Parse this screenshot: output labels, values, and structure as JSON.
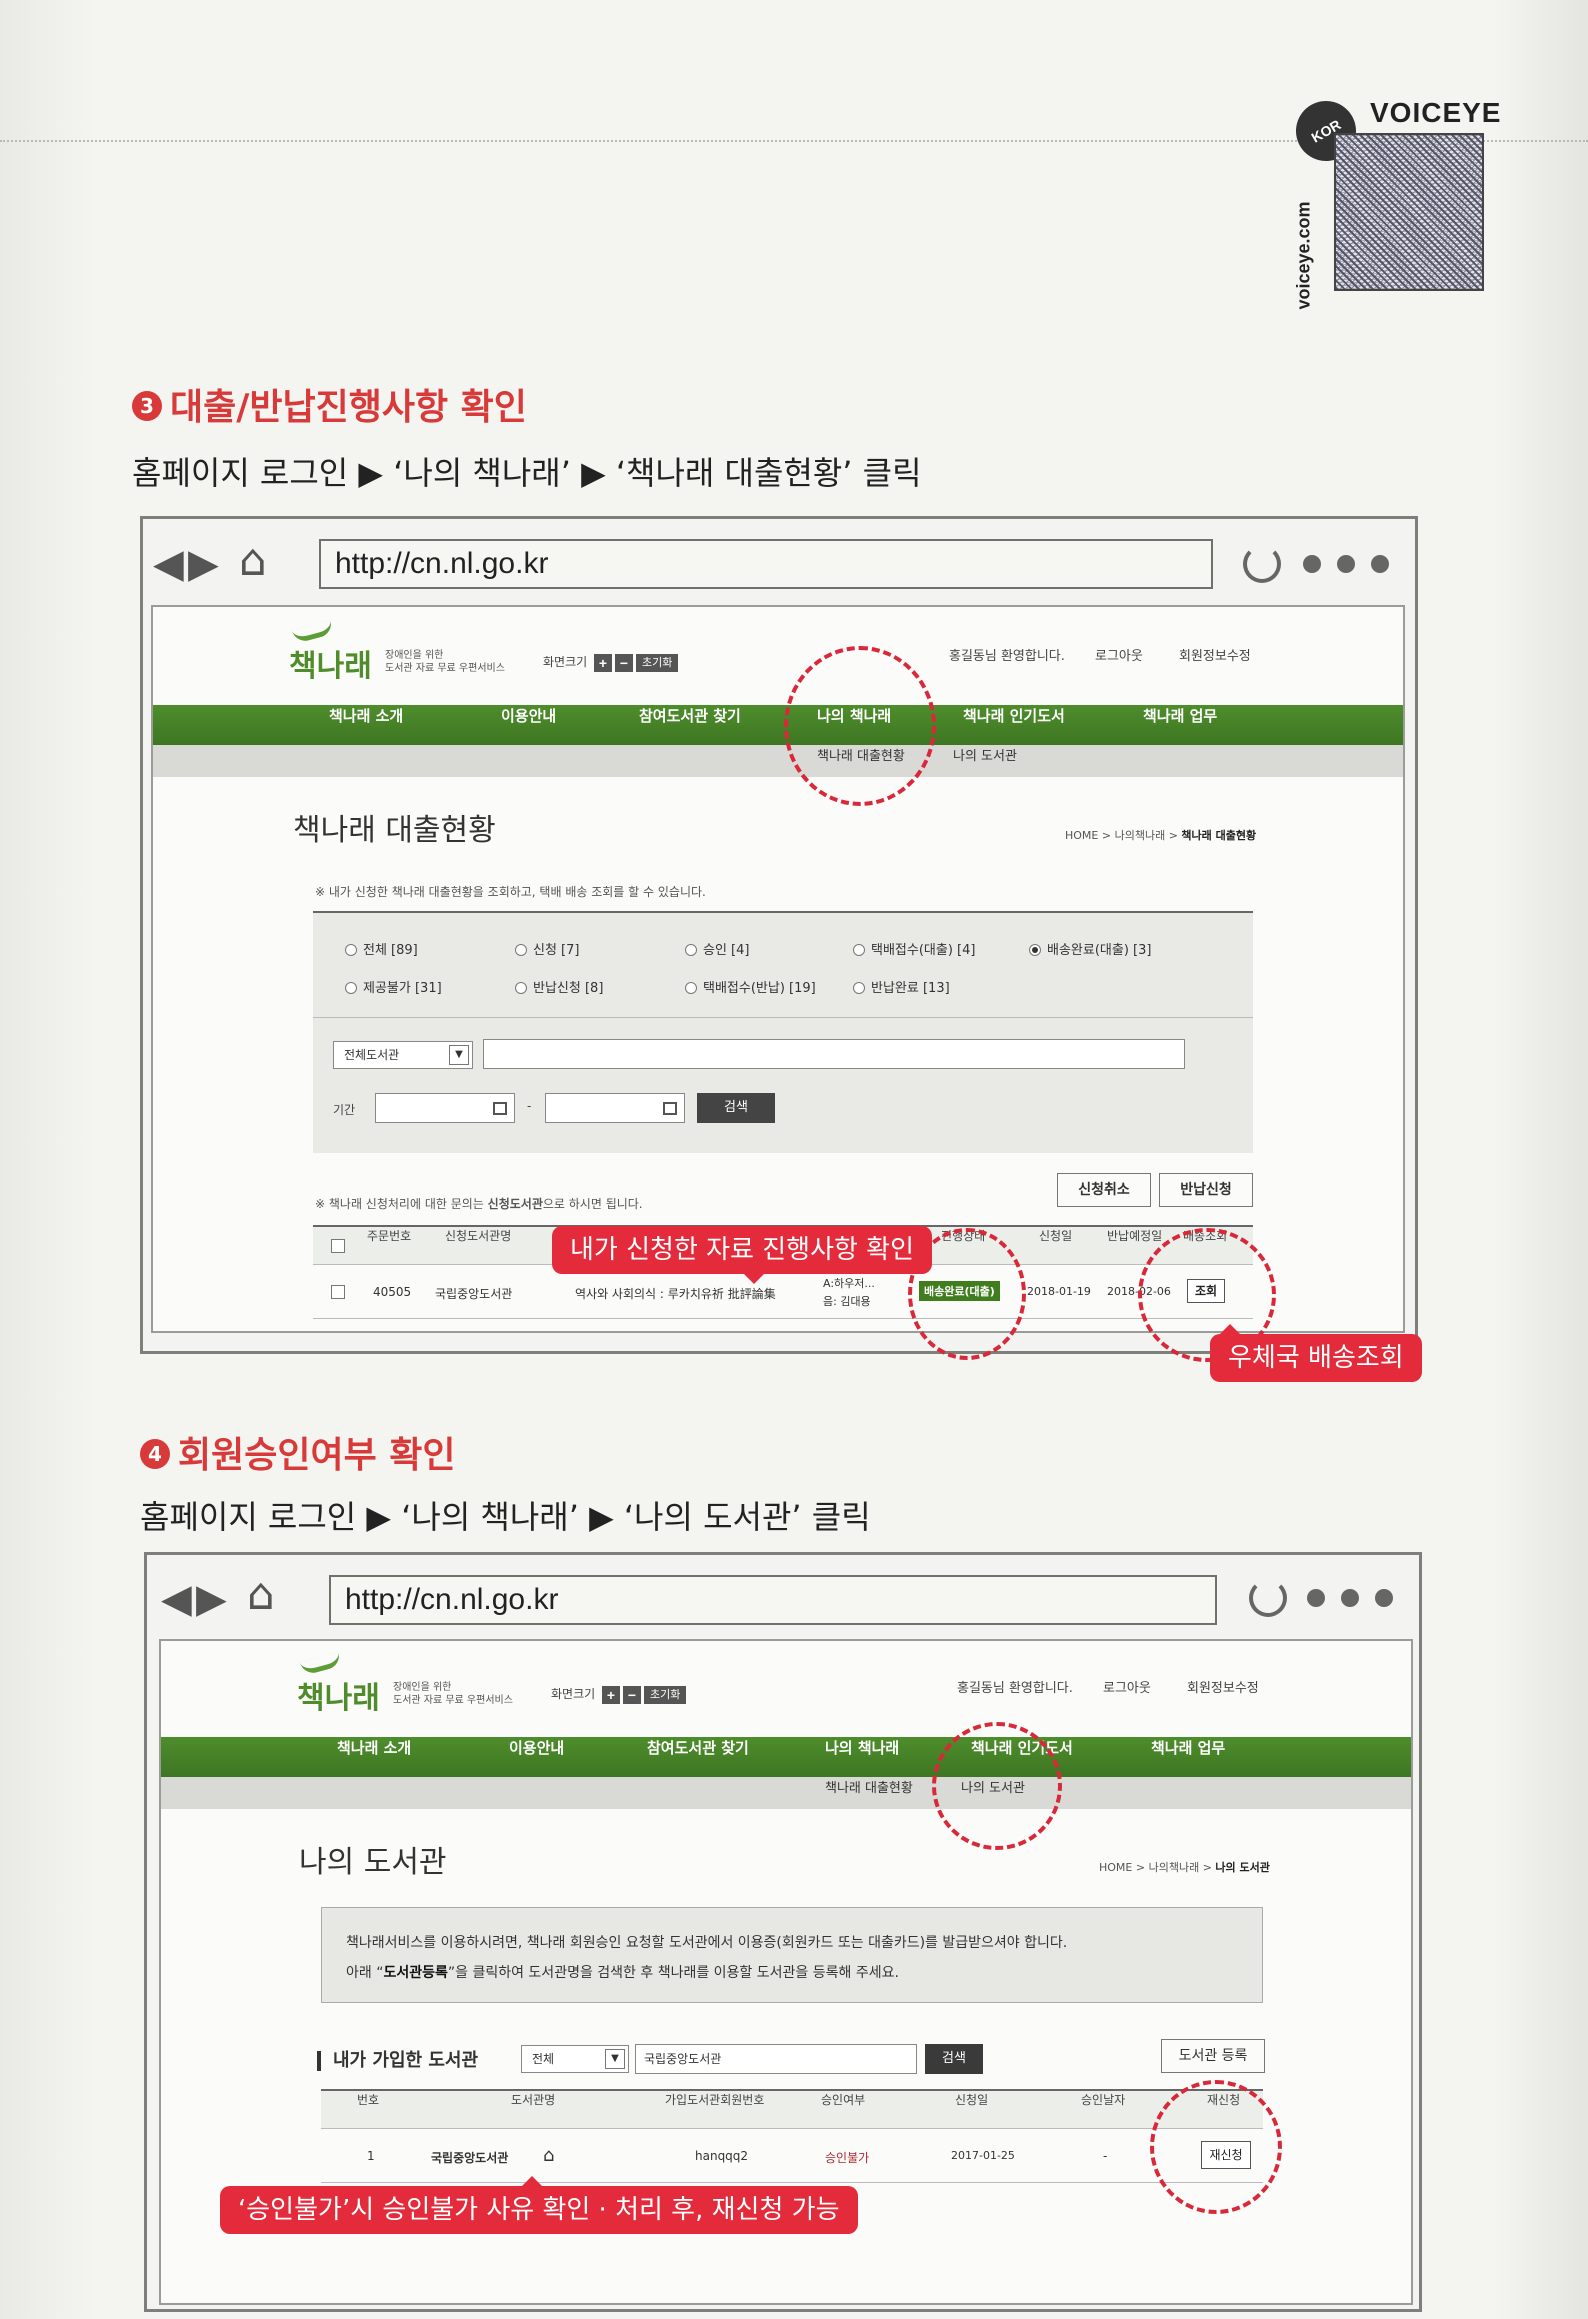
{
  "voiceye": {
    "brand": "VOICEYE",
    "side_text": "voiceye.com",
    "badge": "KOR"
  },
  "section3": {
    "num": "3",
    "title": "대출/반납진행사항 확인",
    "instruction": "홈페이지 로그인 ▶ ‘나의 책나래’ ▶ ‘책나래 대출현황’ 클릭",
    "url": "http://cn.nl.go.kr",
    "site": {
      "logo": "책나래",
      "tagline1": "장애인을 위한",
      "tagline2": "도서관 자료 무료 우편서비스",
      "fontsize_label": "화면크기",
      "plus": "+",
      "minus": "−",
      "reset": "초기화",
      "welcome": "홍길동님 환영합니다.",
      "logout": "로그아웃",
      "edit_info": "회원정보수정",
      "nav": [
        "책나래 소개",
        "이용안내",
        "참여도서관 찾기",
        "나의 책나래",
        "책나래 인기도서",
        "책나래 업무"
      ],
      "subnav": [
        "책나래 대출현황",
        "나의 도서관"
      ]
    },
    "page_title": "책나래 대출현황",
    "breadcrumb": {
      "home": "HOME",
      "mid": "나의책나래",
      "current": "책나래 대출현황"
    },
    "notice": "※ 내가 신청한 책나래 대출현황을 조회하고, 택배 배송 조회를 할 수 있습니다.",
    "radios": [
      "전체 [89]",
      "신청 [7]",
      "승인 [4]",
      "택배접수(대출) [4]",
      "배송완료(대출) [3]",
      "제공불가 [31]",
      "반납신청 [8]",
      "택배접수(반납) [19]",
      "반납완료 [13]"
    ],
    "library_select": "전체도서관",
    "period_label": "기간",
    "search_btn": "검색",
    "inquiry_note_pre": "※ 책나래 신청처리에 대한 문의는 ",
    "inquiry_note_bold": "신청도서관",
    "inquiry_note_post": "으로 하시면 됩니다.",
    "cancel_btn": "신청취소",
    "return_btn": "반납신청",
    "table_headers": [
      "주문번호",
      "신청도서관명",
      "진행상태",
      "신청일",
      "반납예정일",
      "배송조회"
    ],
    "row": {
      "order_no": "40505",
      "library": "국립중앙도서관",
      "title": "역사와 사회의식 : 루카치유祈 批評論集",
      "author1": "A:하우저...",
      "author2": "음: 김대용",
      "status": "배송완료(대출)",
      "apply_date": "2018-01-19",
      "return_date": "2018-02-06",
      "track_btn": "조회"
    },
    "callout_progress": "내가 신청한 자료 진행사항 확인",
    "callout_delivery": "우체국 배송조회"
  },
  "section4": {
    "num": "4",
    "title": "회원승인여부 확인",
    "instruction": "홈페이지 로그인 ▶ ‘나의 책나래’ ▶ ‘나의 도서관’ 클릭",
    "url": "http://cn.nl.go.kr",
    "page_title": "나의 도서관",
    "breadcrumb": {
      "home": "HOME",
      "mid": "나의책나래",
      "current": "나의 도서관"
    },
    "info_line1": "책나래서비스를 이용하시려면, 책나래 회원승인 요청할 도서관에서 이용증(회원카드 또는 대출카드)를 발급받으셔야 합니다.",
    "info_line2_pre": "아래 “",
    "info_line2_bold": "도서관등록",
    "info_line2_post": "”을 클릭하여 도서관명을 검색한 후 책나래를 이용할 도서관을 등록해 주세요.",
    "joined_label": "내가 가입한 도서관",
    "filter_select": "전체",
    "search_value": "국립중앙도서관",
    "search_btn": "검색",
    "register_btn": "도서관 등록",
    "table_headers": [
      "번호",
      "도서관명",
      "가입도서관회원번호",
      "승인여부",
      "신청일",
      "승인날자",
      "재신청"
    ],
    "row": {
      "no": "1",
      "library": "국립중앙도서관",
      "member_no": "hanqqq2",
      "approval": "승인불가",
      "apply_date": "2017-01-25",
      "approved_date": "-",
      "reapply_btn": "재신청"
    },
    "callout_reapply": "‘승인불가’시 승인불가 사유 확인 · 처리 후, 재신청 가능"
  }
}
